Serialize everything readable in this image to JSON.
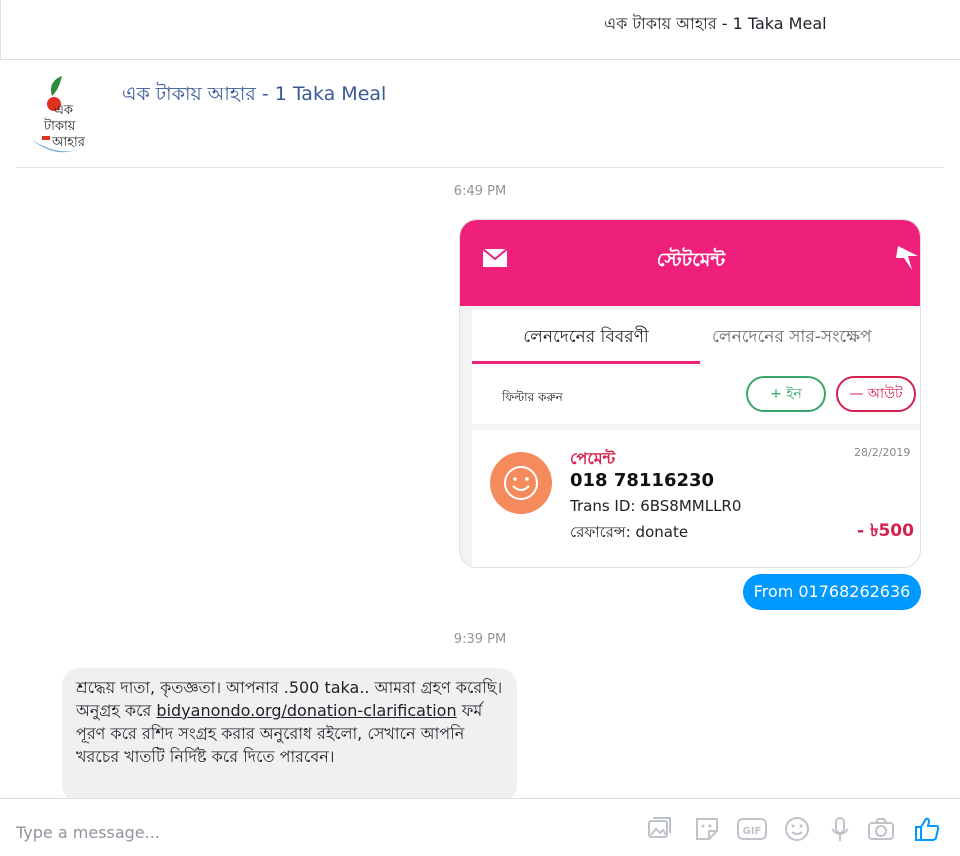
{
  "window": {
    "title": "এক টাকায় আহার - 1 Taka Meal"
  },
  "header": {
    "page_name": "এক টাকায় আহার - 1 Taka Meal",
    "logo_text_line1": "এক",
    "logo_text_line2": "টাকায়",
    "logo_text_line3": "আহার"
  },
  "messages": {
    "timestamp_1": "6:49 PM",
    "timestamp_2": "9:39 PM",
    "screenshot": {
      "header_title": "স্টেটমেন্ট",
      "tab_active": "লেনদেনের বিবরণী",
      "tab_inactive": "লেনদেনের সার-সংক্ষেপ",
      "filter_label": "ফিল্টার করুন",
      "filter_in": "+ ইন",
      "filter_out": "— আউট",
      "tx_label": "পেমেন্ট",
      "tx_date": "28/2/2019",
      "tx_number": "018 78116230",
      "tx_trans_id": "Trans ID: 6BS8MMLLR0",
      "tx_reference": "রেফারেন্স: donate",
      "tx_amount": "- ৳500"
    },
    "sent_bubble": "From 01768262636",
    "reply": {
      "text_before_link": "শ্রদ্ধেয় দাতা, কৃতজ্ঞতা। আপনার .500 taka.. আমরা গ্রহণ করেছি। অনুগ্রহ করে ",
      "link_text": "bidyanondo.org/donation-clarification",
      "text_after_link": " ফর্ম পূরণ করে রশিদ সংগ্রহ করার অনুরোধ রইলো, সেখানে আপনি খরচের খাতটি নির্দিষ্ট করে দিতে পারবেন।"
    }
  },
  "composer": {
    "placeholder": "Type a message...",
    "icons": [
      "image-icon",
      "sticker-icon",
      "gif-icon",
      "emoji-icon",
      "microphone-icon",
      "camera-icon",
      "like-icon"
    ],
    "gif_label": "GIF"
  },
  "colors": {
    "accent": "#0099ff",
    "pink": "#ef1f7c",
    "link": "#385898"
  }
}
